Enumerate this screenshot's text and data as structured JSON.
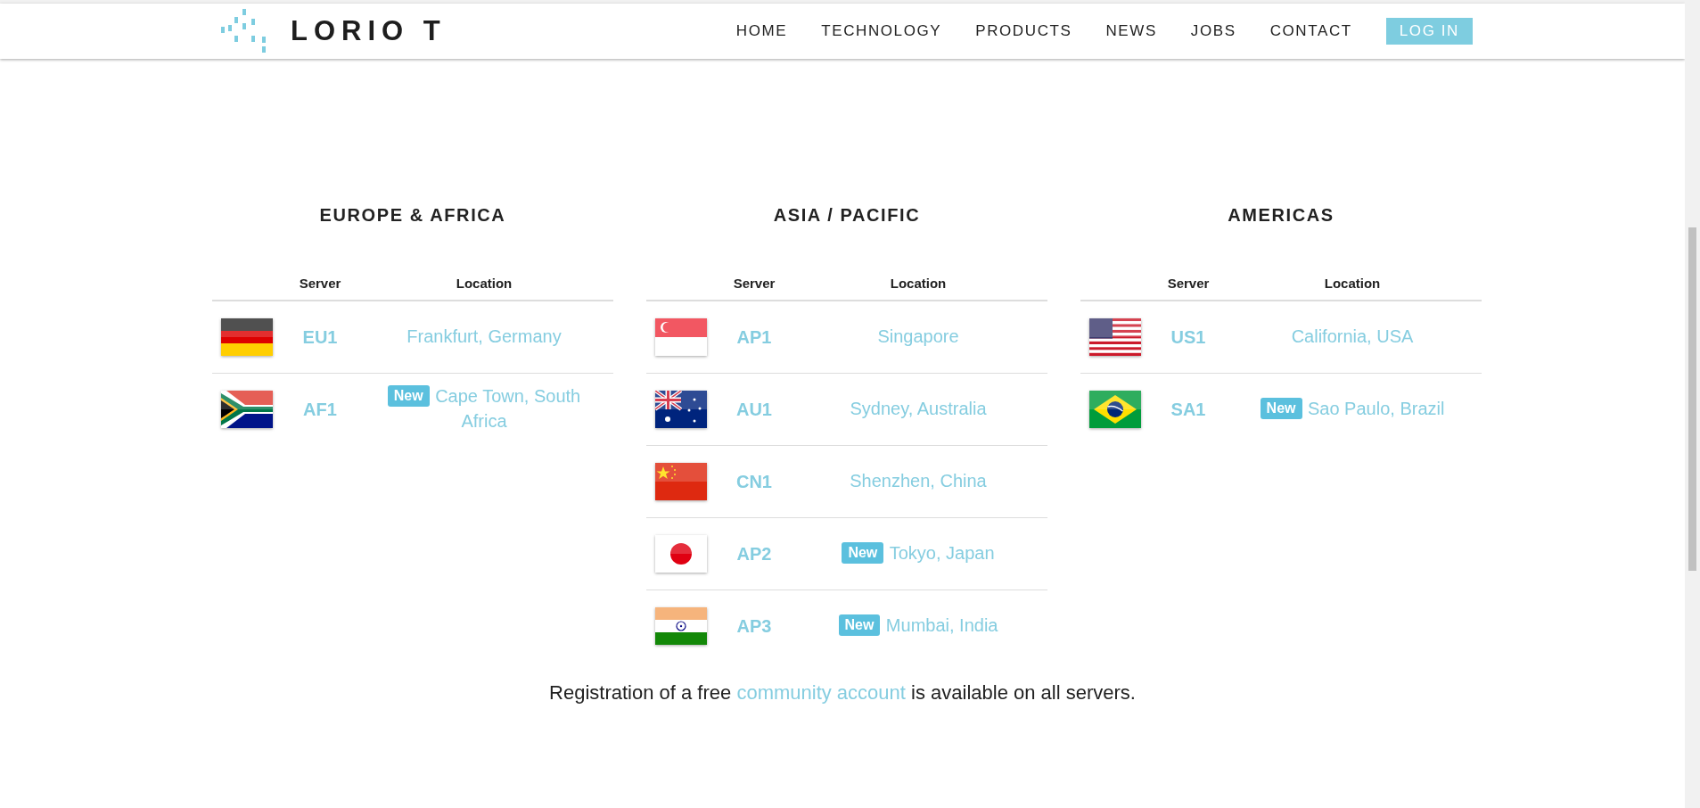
{
  "header": {
    "logo": "LORIO T",
    "nav": [
      {
        "label": "HOME",
        "kind": "link"
      },
      {
        "label": "TECHNOLOGY",
        "kind": "link"
      },
      {
        "label": "PRODUCTS",
        "kind": "link"
      },
      {
        "label": "NEWS",
        "kind": "link"
      },
      {
        "label": "JOBS",
        "kind": "link"
      },
      {
        "label": "CONTACT",
        "kind": "link"
      },
      {
        "label": "LOG IN",
        "kind": "button"
      }
    ]
  },
  "regions": [
    {
      "title": "EUROPE & AFRICA",
      "columns": [
        "Server",
        "Location"
      ],
      "rows": [
        {
          "kind": "de",
          "server": "EU1",
          "location": "Frankfurt, Germany"
        },
        {
          "kind": "za",
          "server": "AF1",
          "badge": "New",
          "location": "Cape Town, South Africa"
        }
      ]
    },
    {
      "title": "ASIA / PACIFIC",
      "columns": [
        "Server",
        "Location"
      ],
      "rows": [
        {
          "kind": "sg",
          "server": "AP1",
          "location": "Singapore"
        },
        {
          "kind": "au",
          "server": "AU1",
          "location": "Sydney, Australia"
        },
        {
          "kind": "cn",
          "server": "CN1",
          "location": "Shenzhen, China"
        },
        {
          "kind": "jp",
          "server": "AP2",
          "badge": "New",
          "location": "Tokyo, Japan"
        },
        {
          "kind": "in",
          "server": "AP3",
          "badge": "New",
          "location": "Mumbai, India"
        }
      ]
    },
    {
      "title": "AMERICAS",
      "columns": [
        "Server",
        "Location"
      ],
      "rows": [
        {
          "kind": "us",
          "server": "US1",
          "location": "California, USA"
        },
        {
          "kind": "br",
          "server": "SA1",
          "badge": "New",
          "location": "Sao Paulo, Brazil"
        }
      ]
    }
  ],
  "footer": {
    "before": "Registration of a free ",
    "link": "community account",
    "after": " is available on all servers."
  }
}
